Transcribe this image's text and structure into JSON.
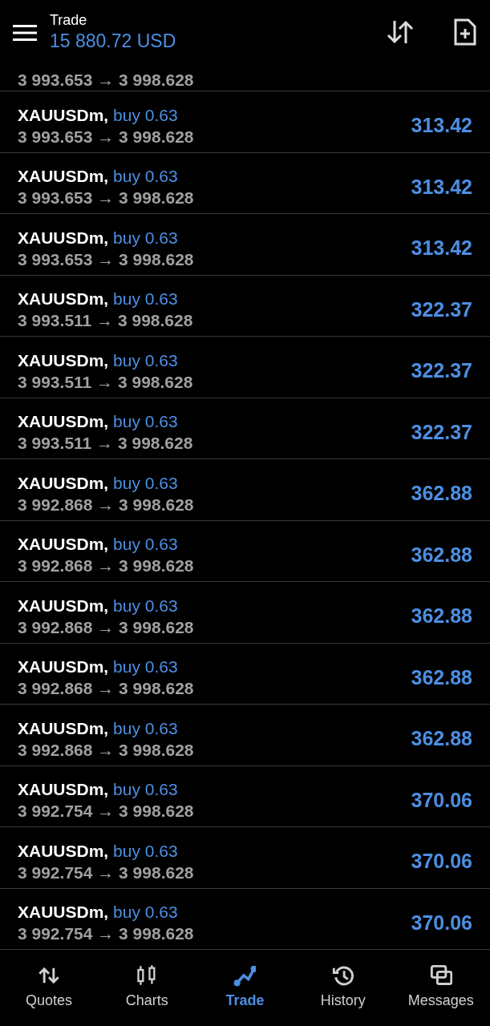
{
  "header": {
    "title": "Trade",
    "balance": "15 880.72 USD"
  },
  "partial_row": {
    "prices": "3 993.653 → 3 998.628"
  },
  "positions": [
    {
      "symbol": "XAUUSDm,",
      "side": "buy 0.63",
      "prices": "3 993.653 → 3 998.628",
      "profit": "313.42"
    },
    {
      "symbol": "XAUUSDm,",
      "side": "buy 0.63",
      "prices": "3 993.653 → 3 998.628",
      "profit": "313.42"
    },
    {
      "symbol": "XAUUSDm,",
      "side": "buy 0.63",
      "prices": "3 993.653 → 3 998.628",
      "profit": "313.42"
    },
    {
      "symbol": "XAUUSDm,",
      "side": "buy 0.63",
      "prices": "3 993.511 → 3 998.628",
      "profit": "322.37"
    },
    {
      "symbol": "XAUUSDm,",
      "side": "buy 0.63",
      "prices": "3 993.511 → 3 998.628",
      "profit": "322.37"
    },
    {
      "symbol": "XAUUSDm,",
      "side": "buy 0.63",
      "prices": "3 993.511 → 3 998.628",
      "profit": "322.37"
    },
    {
      "symbol": "XAUUSDm,",
      "side": "buy 0.63",
      "prices": "3 992.868 → 3 998.628",
      "profit": "362.88"
    },
    {
      "symbol": "XAUUSDm,",
      "side": "buy 0.63",
      "prices": "3 992.868 → 3 998.628",
      "profit": "362.88"
    },
    {
      "symbol": "XAUUSDm,",
      "side": "buy 0.63",
      "prices": "3 992.868 → 3 998.628",
      "profit": "362.88"
    },
    {
      "symbol": "XAUUSDm,",
      "side": "buy 0.63",
      "prices": "3 992.868 → 3 998.628",
      "profit": "362.88"
    },
    {
      "symbol": "XAUUSDm,",
      "side": "buy 0.63",
      "prices": "3 992.868 → 3 998.628",
      "profit": "362.88"
    },
    {
      "symbol": "XAUUSDm,",
      "side": "buy 0.63",
      "prices": "3 992.754 → 3 998.628",
      "profit": "370.06"
    },
    {
      "symbol": "XAUUSDm,",
      "side": "buy 0.63",
      "prices": "3 992.754 → 3 998.628",
      "profit": "370.06"
    },
    {
      "symbol": "XAUUSDm,",
      "side": "buy 0.63",
      "prices": "3 992.754 → 3 998.628",
      "profit": "370.06"
    }
  ],
  "nav": [
    {
      "kind": "quotes",
      "label": "Quotes",
      "selected": false
    },
    {
      "kind": "charts",
      "label": "Charts",
      "selected": false
    },
    {
      "kind": "trade",
      "label": "Trade",
      "selected": true
    },
    {
      "kind": "history",
      "label": "History",
      "selected": false
    },
    {
      "kind": "messages",
      "label": "Messages",
      "selected": false
    }
  ]
}
